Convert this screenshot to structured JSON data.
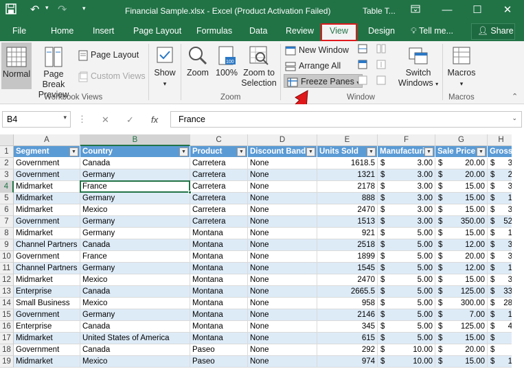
{
  "titlebar": {
    "title": "Financial Sample.xlsx - Excel (Product Activation Failed)",
    "context": "Table T...",
    "bg": "#217346"
  },
  "tabs": [
    "File",
    "Home",
    "Insert",
    "Page Layout",
    "Formulas",
    "Data",
    "Review",
    "View",
    "Design",
    "Tell me...",
    "Share"
  ],
  "active_tab": "View",
  "ribbon": {
    "workbook_views": {
      "normal": "Normal",
      "page_break_1": "Page Break",
      "page_break_2": "Preview",
      "page_layout": "Page Layout",
      "custom_views": "Custom Views",
      "group": "Workbook Views"
    },
    "show": "Show",
    "zoom": {
      "zoom": "Zoom",
      "hundred": "100%",
      "to_selection_1": "Zoom to",
      "to_selection_2": "Selection",
      "group": "Zoom"
    },
    "window": {
      "new_window": "New Window",
      "arrange_all": "Arrange All",
      "freeze_panes": "Freeze Panes",
      "switch_1": "Switch",
      "switch_2": "Windows",
      "group": "Window"
    },
    "macros": {
      "label": "Macros",
      "group": "Macros"
    }
  },
  "formula_bar": {
    "name_box": "B4",
    "cancel_icon": "✕",
    "enter_icon": "✓",
    "fx": "fx",
    "value": "France"
  },
  "sheet": {
    "columns": [
      "A",
      "B",
      "C",
      "D",
      "E",
      "F",
      "G",
      "H"
    ],
    "selected_column": "B",
    "selected_row": "4",
    "headers": [
      "Segment",
      "Country",
      "Product",
      "Discount Band",
      "Units Sold",
      "Manufacturi",
      "Sale Price",
      "Gross"
    ],
    "rows": [
      {
        "n": "2",
        "seg": "Government",
        "cty": "Canada",
        "prod": "Carretera",
        "band": "None",
        "units": "1618.5",
        "mfg_c": "$",
        "mfg": "3.00",
        "sp_c": "$",
        "sp": "20.00",
        "g_c": "$",
        "g": "3"
      },
      {
        "n": "3",
        "seg": "Government",
        "cty": "Germany",
        "prod": "Carretera",
        "band": "None",
        "units": "1321",
        "mfg_c": "$",
        "mfg": "3.00",
        "sp_c": "$",
        "sp": "20.00",
        "g_c": "$",
        "g": "2"
      },
      {
        "n": "4",
        "seg": "Midmarket",
        "cty": "France",
        "prod": "Carretera",
        "band": "None",
        "units": "2178",
        "mfg_c": "$",
        "mfg": "3.00",
        "sp_c": "$",
        "sp": "15.00",
        "g_c": "$",
        "g": "3"
      },
      {
        "n": "5",
        "seg": "Midmarket",
        "cty": "Germany",
        "prod": "Carretera",
        "band": "None",
        "units": "888",
        "mfg_c": "$",
        "mfg": "3.00",
        "sp_c": "$",
        "sp": "15.00",
        "g_c": "$",
        "g": "1"
      },
      {
        "n": "6",
        "seg": "Midmarket",
        "cty": "Mexico",
        "prod": "Carretera",
        "band": "None",
        "units": "2470",
        "mfg_c": "$",
        "mfg": "3.00",
        "sp_c": "$",
        "sp": "15.00",
        "g_c": "$",
        "g": "3"
      },
      {
        "n": "7",
        "seg": "Government",
        "cty": "Germany",
        "prod": "Carretera",
        "band": "None",
        "units": "1513",
        "mfg_c": "$",
        "mfg": "3.00",
        "sp_c": "$",
        "sp": "350.00",
        "g_c": "$",
        "g": "52"
      },
      {
        "n": "8",
        "seg": "Midmarket",
        "cty": "Germany",
        "prod": "Montana",
        "band": "None",
        "units": "921",
        "mfg_c": "$",
        "mfg": "5.00",
        "sp_c": "$",
        "sp": "15.00",
        "g_c": "$",
        "g": "1"
      },
      {
        "n": "9",
        "seg": "Channel Partners",
        "cty": "Canada",
        "prod": "Montana",
        "band": "None",
        "units": "2518",
        "mfg_c": "$",
        "mfg": "5.00",
        "sp_c": "$",
        "sp": "12.00",
        "g_c": "$",
        "g": "3"
      },
      {
        "n": "10",
        "seg": "Government",
        "cty": "France",
        "prod": "Montana",
        "band": "None",
        "units": "1899",
        "mfg_c": "$",
        "mfg": "5.00",
        "sp_c": "$",
        "sp": "20.00",
        "g_c": "$",
        "g": "3"
      },
      {
        "n": "11",
        "seg": "Channel Partners",
        "cty": "Germany",
        "prod": "Montana",
        "band": "None",
        "units": "1545",
        "mfg_c": "$",
        "mfg": "5.00",
        "sp_c": "$",
        "sp": "12.00",
        "g_c": "$",
        "g": "1"
      },
      {
        "n": "12",
        "seg": "Midmarket",
        "cty": "Mexico",
        "prod": "Montana",
        "band": "None",
        "units": "2470",
        "mfg_c": "$",
        "mfg": "5.00",
        "sp_c": "$",
        "sp": "15.00",
        "g_c": "$",
        "g": "3"
      },
      {
        "n": "13",
        "seg": "Enterprise",
        "cty": "Canada",
        "prod": "Montana",
        "band": "None",
        "units": "2665.5",
        "mfg_c": "$",
        "mfg": "5.00",
        "sp_c": "$",
        "sp": "125.00",
        "g_c": "$",
        "g": "33"
      },
      {
        "n": "14",
        "seg": "Small Business",
        "cty": "Mexico",
        "prod": "Montana",
        "band": "None",
        "units": "958",
        "mfg_c": "$",
        "mfg": "5.00",
        "sp_c": "$",
        "sp": "300.00",
        "g_c": "$",
        "g": "28"
      },
      {
        "n": "15",
        "seg": "Government",
        "cty": "Germany",
        "prod": "Montana",
        "band": "None",
        "units": "2146",
        "mfg_c": "$",
        "mfg": "5.00",
        "sp_c": "$",
        "sp": "7.00",
        "g_c": "$",
        "g": "1"
      },
      {
        "n": "16",
        "seg": "Enterprise",
        "cty": "Canada",
        "prod": "Montana",
        "band": "None",
        "units": "345",
        "mfg_c": "$",
        "mfg": "5.00",
        "sp_c": "$",
        "sp": "125.00",
        "g_c": "$",
        "g": "4"
      },
      {
        "n": "17",
        "seg": "Midmarket",
        "cty": "United States of America",
        "prod": "Montana",
        "band": "None",
        "units": "615",
        "mfg_c": "$",
        "mfg": "5.00",
        "sp_c": "$",
        "sp": "15.00",
        "g_c": "$",
        "g": ""
      },
      {
        "n": "18",
        "seg": "Government",
        "cty": "Canada",
        "prod": "Paseo",
        "band": "None",
        "units": "292",
        "mfg_c": "$",
        "mfg": "10.00",
        "sp_c": "$",
        "sp": "20.00",
        "g_c": "$",
        "g": ""
      },
      {
        "n": "19",
        "seg": "Midmarket",
        "cty": "Mexico",
        "prod": "Paseo",
        "band": "None",
        "units": "974",
        "mfg_c": "$",
        "mfg": "10.00",
        "sp_c": "$",
        "sp": "15.00",
        "g_c": "$",
        "g": "1"
      }
    ]
  },
  "colors": {
    "excel_green": "#217346",
    "table_header": "#5b9bd5",
    "table_band": "#ddebf7",
    "highlight": "#e0181b"
  },
  "annotation": "red-arrow-pointing-at-freeze-panes"
}
